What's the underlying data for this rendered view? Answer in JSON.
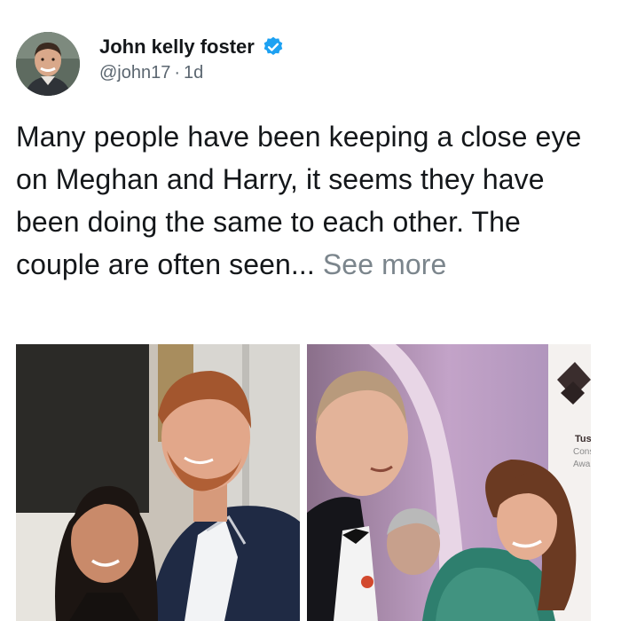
{
  "tweet": {
    "author": {
      "display_name": "John kelly foster",
      "handle": "@john17",
      "time": "1d",
      "verified": true,
      "avatar_icon": "profile-photo"
    },
    "text": "Many people have been keeping a close eye on Meghan and Harry, it seems they have been doing the same to each other. The couple are often seen...",
    "see_more_label": "See more",
    "media": [
      {
        "icon": "photo-harry-meghan"
      },
      {
        "icon": "photo-william-kate",
        "sign_text": [
          "Tusk",
          "Cons",
          "Awa"
        ]
      }
    ]
  },
  "colors": {
    "text": "#14171a",
    "secondary": "#5b6670",
    "verified": "#1da1f2",
    "see_more": "#7b858c"
  }
}
